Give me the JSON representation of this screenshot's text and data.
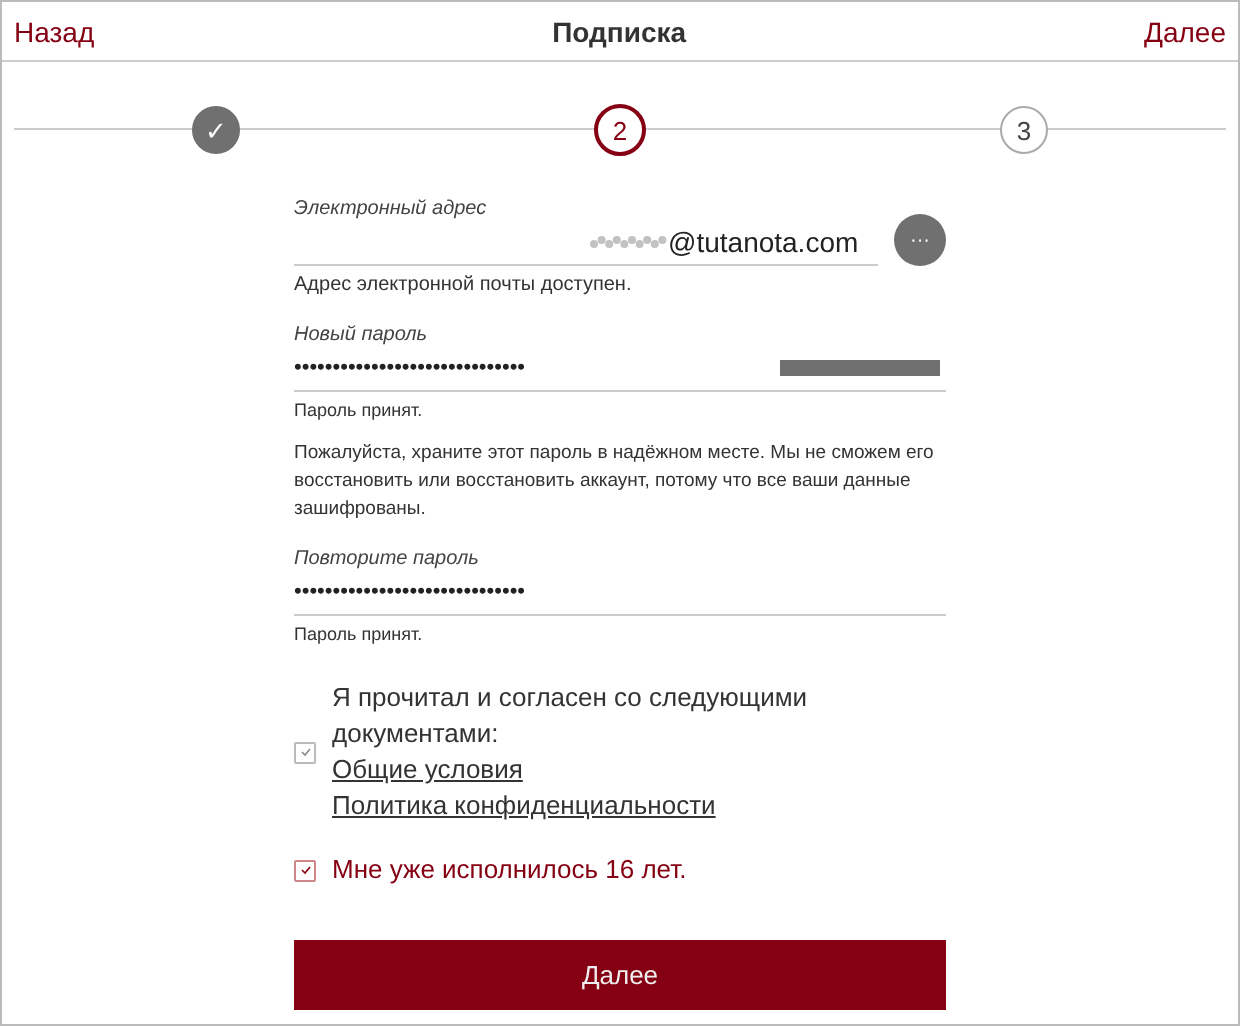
{
  "header": {
    "back": "Назад",
    "title": "Подписка",
    "next": "Далее"
  },
  "steps": [
    {
      "label": "✓",
      "kind": "done"
    },
    {
      "label": "2",
      "kind": "current"
    },
    {
      "label": "3",
      "kind": "pending"
    }
  ],
  "email": {
    "label": "Электронный адрес",
    "value": "@tutanota.com",
    "redacted": true,
    "menu": "···",
    "help": "Адрес электронной почты доступен."
  },
  "password": {
    "label": "Новый пароль",
    "value": "••••••••••••••••••••••••••••••",
    "strength": {
      "level": 1
    },
    "help": "Пароль принят."
  },
  "notice": "Пожалуйста, храните этот пароль в надёжном месте. Мы не сможем его восстановить или восстановить аккаунт, потому что все ваши данные зашифрованы.",
  "repeat": {
    "label": "Повторите пароль",
    "value": "••••••••••••••••••••••••••••••",
    "help": "Пароль принят."
  },
  "agreements": [
    {
      "text": "Я прочитал и согласен со следующими документами:",
      "links": [
        "Общие условия",
        "Политика конфиденциальности"
      ],
      "checked": true,
      "highlighted": false
    },
    {
      "text": "Мне уже исполнилось 16 лет.",
      "checked": true,
      "highlighted": true
    }
  ],
  "submit": "Далее"
}
